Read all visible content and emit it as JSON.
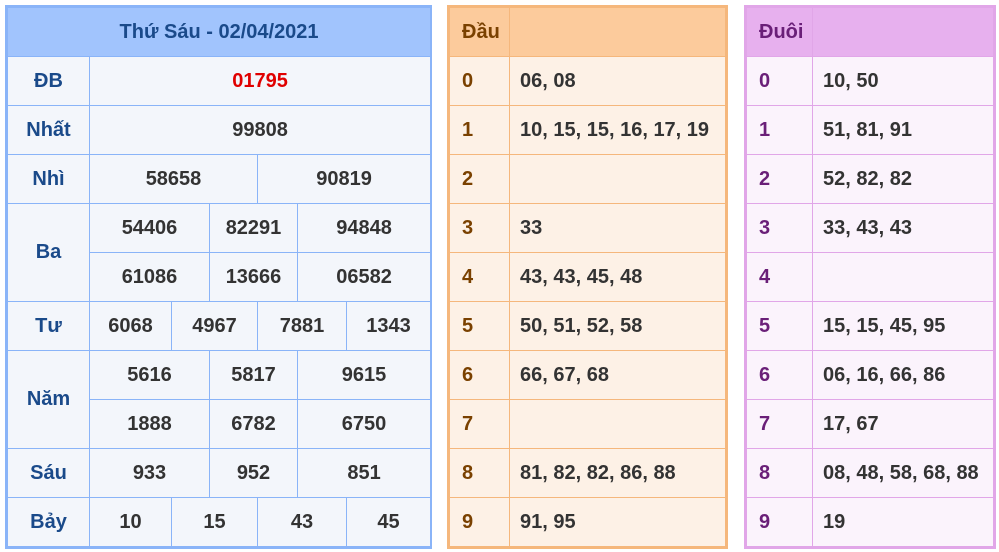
{
  "results": {
    "title": "Thứ Sáu - 02/04/2021",
    "rows": {
      "db": {
        "label": "ĐB",
        "values": [
          "01795"
        ]
      },
      "nhat": {
        "label": "Nhất",
        "values": [
          "99808"
        ]
      },
      "nhi": {
        "label": "Nhì",
        "values": [
          "58658",
          "90819"
        ]
      },
      "ba": {
        "label": "Ba",
        "values": [
          "54406",
          "82291",
          "94848",
          "61086",
          "13666",
          "06582"
        ]
      },
      "tu": {
        "label": "Tư",
        "values": [
          "6068",
          "4967",
          "7881",
          "1343"
        ]
      },
      "nam": {
        "label": "Năm",
        "values": [
          "5616",
          "5817",
          "9615",
          "1888",
          "6782",
          "6750"
        ]
      },
      "sau": {
        "label": "Sáu",
        "values": [
          "933",
          "952",
          "851"
        ]
      },
      "bay": {
        "label": "Bảy",
        "values": [
          "10",
          "15",
          "43",
          "45"
        ]
      }
    },
    "special_color": "#e00000"
  },
  "dau": {
    "header": "Đầu",
    "rows": [
      {
        "digit": "0",
        "values": "06, 08"
      },
      {
        "digit": "1",
        "values": "10, 15, 15, 16, 17, 19"
      },
      {
        "digit": "2",
        "values": ""
      },
      {
        "digit": "3",
        "values": "33"
      },
      {
        "digit": "4",
        "values": "43, 43, 45, 48"
      },
      {
        "digit": "5",
        "values": "50, 51, 52, 58"
      },
      {
        "digit": "6",
        "values": "66, 67, 68"
      },
      {
        "digit": "7",
        "values": ""
      },
      {
        "digit": "8",
        "values": "81, 82, 82, 86, 88"
      },
      {
        "digit": "9",
        "values": "91, 95"
      }
    ]
  },
  "duoi": {
    "header": "Đuôi",
    "rows": [
      {
        "digit": "0",
        "values": "10, 50"
      },
      {
        "digit": "1",
        "values": "51, 81, 91"
      },
      {
        "digit": "2",
        "values": "52, 82, 82"
      },
      {
        "digit": "3",
        "values": "33, 43, 43"
      },
      {
        "digit": "4",
        "values": ""
      },
      {
        "digit": "5",
        "values": "15, 15, 45, 95"
      },
      {
        "digit": "6",
        "values": "06, 16, 66, 86"
      },
      {
        "digit": "7",
        "values": "17, 67"
      },
      {
        "digit": "8",
        "values": "08, 48, 58, 68, 88"
      },
      {
        "digit": "9",
        "values": "19"
      }
    ]
  }
}
